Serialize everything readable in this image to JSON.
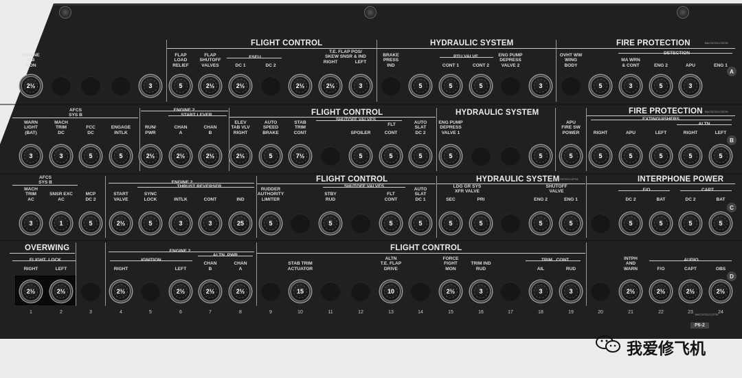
{
  "panel_id": "P6-2",
  "watermark": "我爱修飞机",
  "colors": {
    "panel": "#1e1e1e",
    "text": "#e8e8e8",
    "bg": "#ececec"
  },
  "rows": [
    "A",
    "B",
    "C",
    "D"
  ],
  "columns": [
    "1",
    "2",
    "3",
    "4",
    "5",
    "6",
    "7",
    "8",
    "9",
    "10",
    "11",
    "12",
    "13",
    "14",
    "15",
    "16",
    "17",
    "18",
    "19",
    "20",
    "21",
    "22",
    "23",
    "24"
  ],
  "part_codes": {
    "a": "BACS27DCCSF35",
    "b": "BACS27DCCSF35",
    "c": "BACS27DCCZF43",
    "d": "BACS27DCCZF35"
  },
  "row_a": {
    "headers": {
      "flight_control": "FLIGHT CONTROL",
      "hydraulic_system": "HYDRAULIC SYSTEM",
      "fire_protection": "FIRE PROTECTION"
    },
    "groups": {
      "fseu": "FSEU",
      "ptu_valve": "PTU VALVE",
      "detection": "DETECTION"
    },
    "labels": {
      "c1": "ENGINE\nVIB\nMON",
      "c6": "FLAP\nLOAD\nRELIEF",
      "c7": "FLAP\nSHUTOFF\nVALVES",
      "c8": "DC 1",
      "c9": "DC 2",
      "c11": "T.E. FLAP POS/\nSKEW SNSR & IND",
      "c11r": "RIGHT",
      "c12": "LEFT",
      "c13": "BRAKE\nPRESS\nIND",
      "c15": "CONT 1",
      "c16": "CONT 2",
      "c17": "ENG PUMP\nDEPRESS\nVALVE 2",
      "c19": "OVHT WW\nWING\nBODY",
      "c21": "MA WRN\n& CONT",
      "c22": "ENG 2",
      "c23": "APU",
      "c24": "ENG 1"
    },
    "breakers": [
      "2½",
      "",
      "",
      "",
      "3",
      "5",
      "2½",
      "2½",
      "",
      "2½",
      "2½",
      "3",
      "",
      "5",
      "5",
      "5",
      "",
      "3",
      "",
      "5",
      "3",
      "5",
      "3"
    ]
  },
  "row_b": {
    "headers": {
      "flight_control": "FLIGHT CONTROL",
      "hydraulic_system": "HYDRAULIC SYSTEM",
      "fire_protection": "FIRE PROTECTION"
    },
    "groups": {
      "afcs": "AFCS",
      "sys_b": "SYS B",
      "engine2": "ENGINE 2",
      "start_lever": "START LEVER",
      "shutoff": "SHUTOFF VALVES",
      "flt": "FLT",
      "extinguishers": "EXTINGUISHERS",
      "altn": "ALTN"
    },
    "labels": {
      "c1": "WARN\nLIGHT\n(BAT)",
      "c2": "MACH\nTRIM\nDC",
      "c3": "FCC\nDC",
      "c4": "ENGAGE\nINTLK",
      "c5": "RUN/\nPWR",
      "c6": "CHAN\nA",
      "c7": "CHAN\nB",
      "c8": "ELEV\nTAB VLV\nRIGHT",
      "c9": "AUTO\nSPEED\nBRAKE",
      "c10": "STAB\nTRIM\nCONT",
      "c12": "SPOILER",
      "c13": "CONT",
      "c14": "AUTO\nSLAT\nDC 2",
      "c15": "ENG PUMP\nDEPRESS\nVALVE 1",
      "c19": "APU\nFIRE SW\nPOWER",
      "c20": "RIGHT",
      "c21": "APU",
      "c22": "LEFT",
      "c23": "RIGHT",
      "c24": "LEFT"
    },
    "breakers": [
      "3",
      "3",
      "5",
      "5",
      "2½",
      "2½",
      "2½",
      "2½",
      "5",
      "7½",
      "",
      "5",
      "5",
      "5",
      "5",
      "",
      "",
      "5",
      "5",
      "5",
      "5",
      "5",
      "5",
      "5"
    ]
  },
  "row_c": {
    "headers": {
      "flight_control": "FLIGHT CONTROL",
      "hydraulic_system": "HYDRAULIC SYSTEM",
      "interphone_power": "INTERPHONE POWER"
    },
    "groups": {
      "afcs": "AFCS",
      "sys_b": "SYS B",
      "engine2": "ENGINE 2",
      "thrust_reverser": "THRUST REVERSER",
      "shutoff": "SHUTOFF VALVES",
      "ldg_gr": "LDG GR SYS\nXFR VALVE",
      "shutoff2": "SHUTOFF\nVALVE",
      "fo": "F/O",
      "capt": "CAPT"
    },
    "labels": {
      "c1": "MACH\nTRIM\nAC",
      "c2": "SNSR EXC\nAC",
      "c3": "MCP\nDC 2",
      "c4": "START\nVALVE",
      "c5": "SYNC\nLOCK",
      "c6": "INTLK",
      "c7": "CONT",
      "c8": "IND",
      "c9": "RUDDER\nAUTHORITY\nLIMITER",
      "c11": "STBY\nRUD",
      "c13": "FLT\nCONT",
      "c14": "AUTO\nSLAT\nDC 1",
      "c15": "SEC",
      "c16": "PRI",
      "c18": "ENG 2",
      "c19": "ENG 1",
      "c21": "DC 2",
      "c22": "BAT",
      "c23": "DC 2",
      "c24": "BAT"
    },
    "breakers": [
      "3",
      "1",
      "5",
      "2½",
      "5",
      "3",
      "3",
      "25",
      "5",
      "",
      "5",
      "",
      "5",
      "5",
      "5",
      "5",
      "",
      "5",
      "5",
      "",
      "5",
      "5",
      "5",
      "5"
    ]
  },
  "row_d": {
    "headers": {
      "overwing": "OVERWING",
      "flight_control": "FLIGHT CONTROL"
    },
    "groups": {
      "flight_lock": "FLIGHT  LOCK",
      "engine2": "ENGINE 2",
      "ignition": "IGNITION",
      "altn_pwr": "ALTN  PWR",
      "trim_cont": "TRIM   CONT",
      "audio": "AUDIO"
    },
    "labels": {
      "c1": "RIGHT",
      "c2": "LEFT",
      "c4": "RIGHT",
      "c6": "LEFT",
      "c7": "CHAN\nB",
      "c8": "CHAN\nA",
      "c10": "STAB TRIM\nACTUATOR",
      "c13": "ALTN\nT.E. FLAP\nDRIVE",
      "c15": "FORCE\nFIGHT\nMON",
      "c16": "TRIM IND\nRUD",
      "c18": "AIL",
      "c19": "RUD",
      "c21": "INTPH\nAND\nWARN",
      "c22": "F/O",
      "c23": "CAPT",
      "c24": "OBS"
    },
    "breakers": [
      "2½",
      "2½",
      "",
      "2½",
      "",
      "2½",
      "2½",
      "2½",
      "",
      "15",
      "",
      "",
      "10",
      "",
      "2½",
      "3",
      "",
      "3",
      "3",
      "",
      "2½",
      "2½",
      "2½",
      "2½"
    ]
  }
}
